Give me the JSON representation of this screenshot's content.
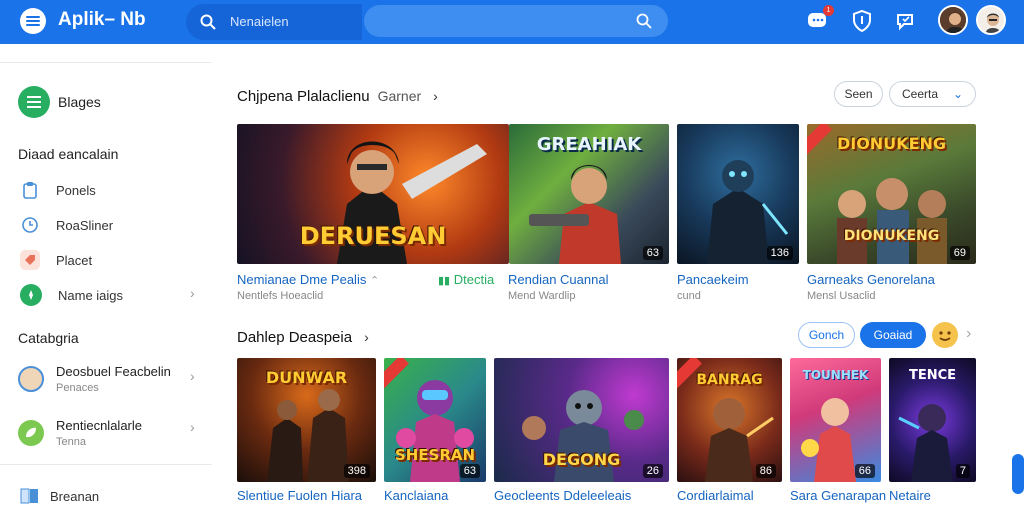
{
  "header": {
    "app_title": "Aplik– Nb",
    "search_placeholder": "Nenaielen",
    "notification_count": "1"
  },
  "sidebar": {
    "brand": "Blages",
    "section1_title": "Diaad eancalain",
    "items": [
      {
        "label": "Ponels",
        "icon": "clipboard-icon",
        "color": "#4a90d9"
      },
      {
        "label": "RoaSliner",
        "icon": "clock-icon",
        "color": "#4a90d9"
      },
      {
        "label": "Placet",
        "icon": "tag-icon",
        "color": "#e8735a"
      },
      {
        "label": "Name iaigs",
        "icon": "compass-icon",
        "color": "#27ae60"
      }
    ],
    "section2_title": "Catabgria",
    "rich_items": [
      {
        "title": "Deosbuel Feacbelin",
        "subtitle": "Penaces"
      },
      {
        "title": "Rentiecnlalarle",
        "subtitle": "Tenna"
      }
    ],
    "bottom_item": "Breanan"
  },
  "row1": {
    "title": "Chjpena Plalaclienu",
    "subtitle": "Garner",
    "filter_left": "Seen",
    "filter_right": "Ceerta",
    "cards": [
      {
        "logo": "DERUESAN",
        "num": "",
        "title": "Nemianae Dme Pealis",
        "subtitle": "Nentlefs Hoeaclid"
      },
      {
        "logo": "GREAHIAK",
        "num": "63",
        "title": "Rendian Cuannal",
        "subtitle": "Mend Wardlip",
        "tag": "Dtectia"
      },
      {
        "logo": "",
        "num": "136",
        "title": "Pancaekeim",
        "subtitle": "cund"
      },
      {
        "logo": "DIONUKENG",
        "num": "69",
        "title": "Garneaks Genorelana",
        "subtitle": "Mensl Usaclid"
      }
    ]
  },
  "row2": {
    "title": "Dahlep Deaspeia",
    "btn_outline": "Gonch",
    "btn_primary": "Goaiad",
    "cards": [
      {
        "logo": "DUNWAR",
        "num": "398",
        "title": "Slentiue Fuolen Hiara",
        "subtitle": ""
      },
      {
        "logo": "SHESRAN",
        "num": "63",
        "title": "Kanclaiana",
        "subtitle": ""
      },
      {
        "logo": "DEGONG",
        "num": "26",
        "title": "Geocleents Ddeleeleais",
        "subtitle": ""
      },
      {
        "logo": "BANRAG",
        "num": "86",
        "title": "Cordiarlaimal",
        "subtitle": ""
      },
      {
        "logo": "TOUNHEK",
        "num": "66",
        "title": "Sara Genarapan",
        "subtitle": ""
      },
      {
        "logo": "TENCE",
        "num": "7",
        "title": "Netaire",
        "subtitle": ""
      }
    ]
  }
}
